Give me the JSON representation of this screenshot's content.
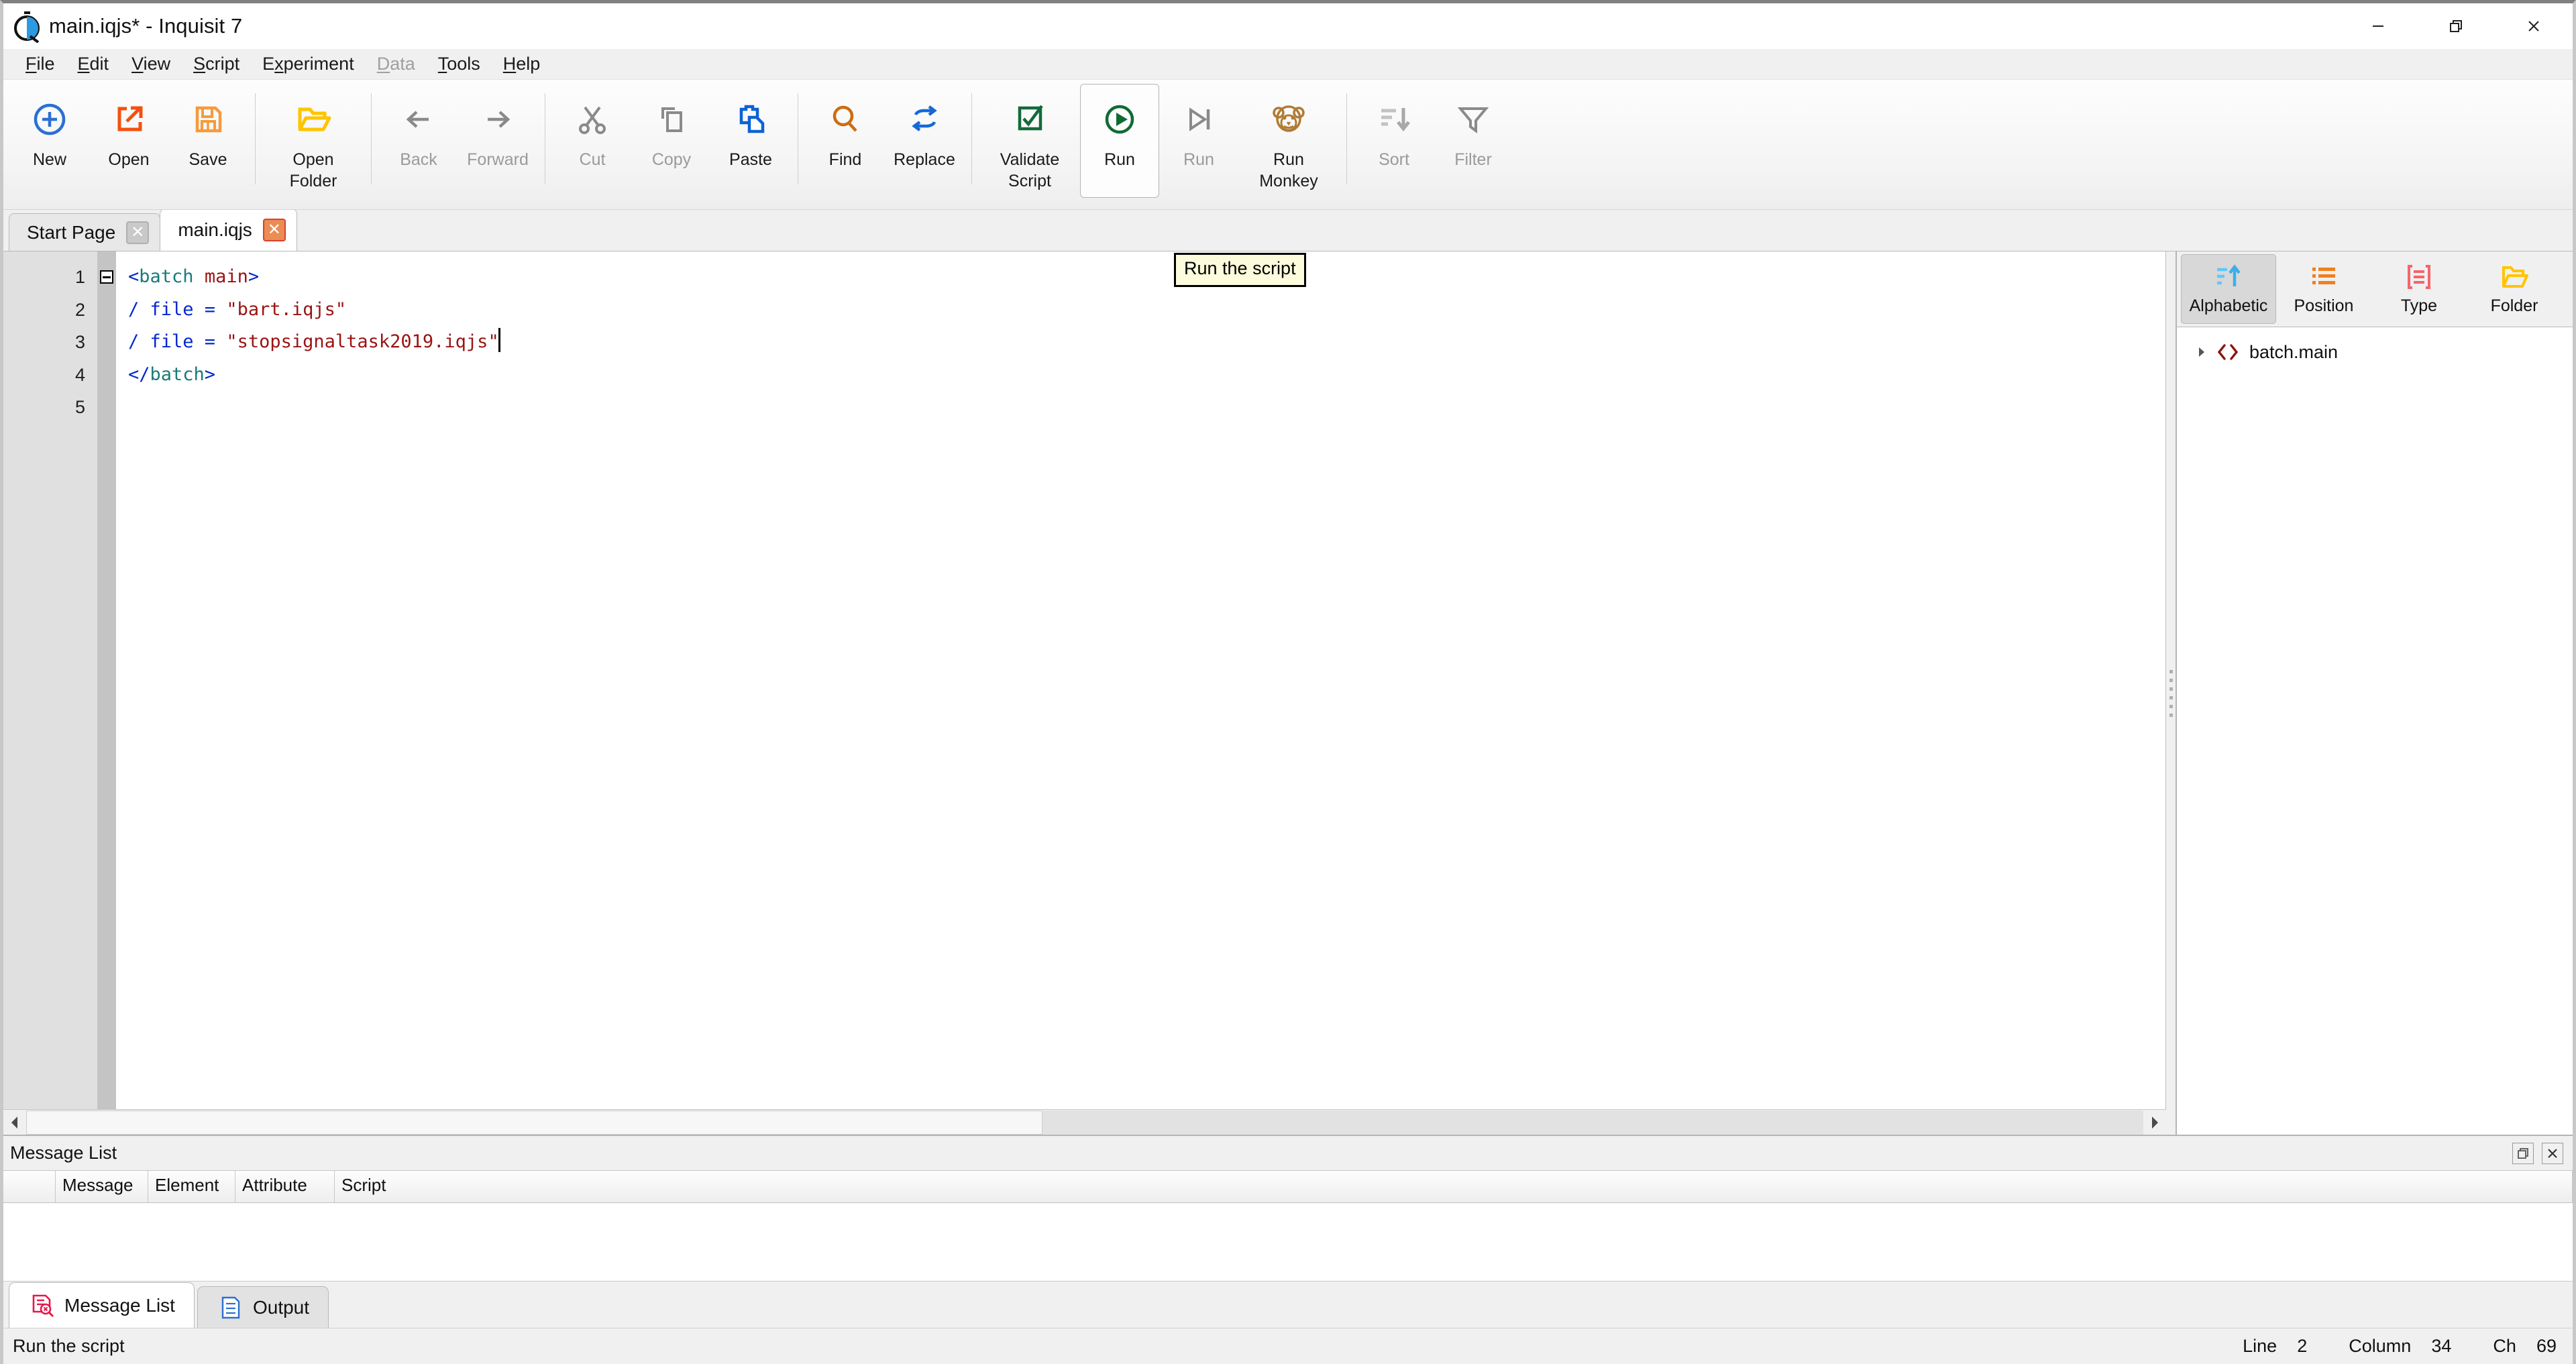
{
  "window": {
    "title": "main.iqjs* - Inquisit 7",
    "logo_icon": "inquisit-stopwatch-logo",
    "controls": {
      "minimize": "minimize-icon",
      "restore": "restore-icon",
      "close": "close-icon"
    }
  },
  "menubar": {
    "items": [
      {
        "label": "File",
        "accel": "F",
        "disabled": false
      },
      {
        "label": "Edit",
        "accel": "E",
        "disabled": false
      },
      {
        "label": "View",
        "accel": "V",
        "disabled": false
      },
      {
        "label": "Script",
        "accel": "S",
        "disabled": false
      },
      {
        "label": "Experiment",
        "accel": "x",
        "disabled": false
      },
      {
        "label": "Data",
        "accel": "D",
        "disabled": true
      },
      {
        "label": "Tools",
        "accel": "T",
        "disabled": false
      },
      {
        "label": "Help",
        "accel": "H",
        "disabled": false
      }
    ]
  },
  "toolbar": {
    "buttons": [
      {
        "label": "New",
        "icon": "new-circle-plus-icon",
        "disabled": false
      },
      {
        "label": "Open",
        "icon": "open-external-arrow-icon",
        "disabled": false
      },
      {
        "label": "Save",
        "icon": "save-floppy-icon",
        "disabled": false
      },
      {
        "label": "Open\nFolder",
        "icon": "open-folder-icon",
        "disabled": false
      },
      {
        "label": "Back",
        "icon": "arrow-left-icon",
        "disabled": true
      },
      {
        "label": "Forward",
        "icon": "arrow-right-icon",
        "disabled": true
      },
      {
        "label": "Cut",
        "icon": "scissors-icon",
        "disabled": true
      },
      {
        "label": "Copy",
        "icon": "copy-icon",
        "disabled": true
      },
      {
        "label": "Paste",
        "icon": "paste-icon",
        "disabled": false
      },
      {
        "label": "Find",
        "icon": "magnifier-icon",
        "disabled": false
      },
      {
        "label": "Replace",
        "icon": "replace-arrows-icon",
        "disabled": false
      },
      {
        "label": "Validate\nScript",
        "icon": "checkbox-check-icon",
        "disabled": false
      },
      {
        "label": "Run",
        "icon": "run-play-circle-icon",
        "disabled": false,
        "hovered": true
      },
      {
        "label": "Run",
        "icon": "run-to-end-icon",
        "disabled": true
      },
      {
        "label": "Run\nMonkey",
        "icon": "monkey-icon",
        "disabled": false
      },
      {
        "label": "Sort",
        "icon": "sort-descending-icon",
        "disabled": true
      },
      {
        "label": "Filter",
        "icon": "funnel-filter-icon",
        "disabled": true
      }
    ],
    "tooltip": "Run the script"
  },
  "tabs": [
    {
      "label": "Start Page",
      "active": false,
      "close_icon": "close-icon"
    },
    {
      "label": "main.iqjs",
      "active": true,
      "close_icon": "close-icon"
    }
  ],
  "editor": {
    "line_numbers": [
      "1",
      "2",
      "3",
      "4",
      "5"
    ],
    "fold_marker_line": 1,
    "lines": [
      {
        "tokens": [
          {
            "t": "<",
            "c": "tok-punc"
          },
          {
            "t": "batch",
            "c": "tok-tag"
          },
          {
            "t": " ",
            "c": "tok-plain"
          },
          {
            "t": "main",
            "c": "tok-name"
          },
          {
            "t": ">",
            "c": "tok-punc"
          }
        ]
      },
      {
        "tokens": [
          {
            "t": "/ file = ",
            "c": "tok-attr"
          },
          {
            "t": "\"bart.iqjs\"",
            "c": "tok-str"
          }
        ]
      },
      {
        "tokens": [
          {
            "t": "/ file = ",
            "c": "tok-attr"
          },
          {
            "t": "\"stopsignaltask2019.iqjs\"",
            "c": "tok-str"
          }
        ],
        "caret": true
      },
      {
        "tokens": [
          {
            "t": "</",
            "c": "tok-punc"
          },
          {
            "t": "batch",
            "c": "tok-tag"
          },
          {
            "t": ">",
            "c": "tok-punc"
          }
        ]
      },
      {
        "tokens": []
      }
    ]
  },
  "right_panel": {
    "view_buttons": [
      {
        "label": "Alphabetic",
        "icon": "sort-alphabetic-icon",
        "selected": true
      },
      {
        "label": "Position",
        "icon": "list-position-icon",
        "selected": false
      },
      {
        "label": "Type",
        "icon": "type-brackets-icon",
        "selected": false
      },
      {
        "label": "Folder",
        "icon": "folder-icon",
        "selected": false
      }
    ],
    "tree": [
      {
        "label": "batch.main",
        "icon": "code-brackets-icon",
        "expander": "chevron-right-icon"
      }
    ]
  },
  "bottom_panel": {
    "title": "Message List",
    "actions": [
      {
        "icon": "float-window-icon",
        "name": "float"
      },
      {
        "icon": "close-icon",
        "name": "close"
      }
    ],
    "columns": [
      "",
      "Message",
      "Element",
      "Attribute",
      "Script"
    ],
    "rows": [],
    "tabs": [
      {
        "label": "Message List",
        "icon": "message-list-icon",
        "active": true
      },
      {
        "label": "Output",
        "icon": "output-document-icon",
        "active": false
      }
    ]
  },
  "statusbar": {
    "message": "Run the script",
    "line_label": "Line",
    "line_value": "2",
    "column_label": "Column",
    "column_value": "34",
    "ch_label": "Ch",
    "ch_value": "69"
  },
  "colors": {
    "accent_green": "#0f6b34",
    "accent_orange": "#f0801e",
    "accent_blue": "#1866c8",
    "accent_yellow": "#ffc400",
    "tab_close_red": "#d8412d",
    "tooltip_bg": "#fcfbdc"
  }
}
